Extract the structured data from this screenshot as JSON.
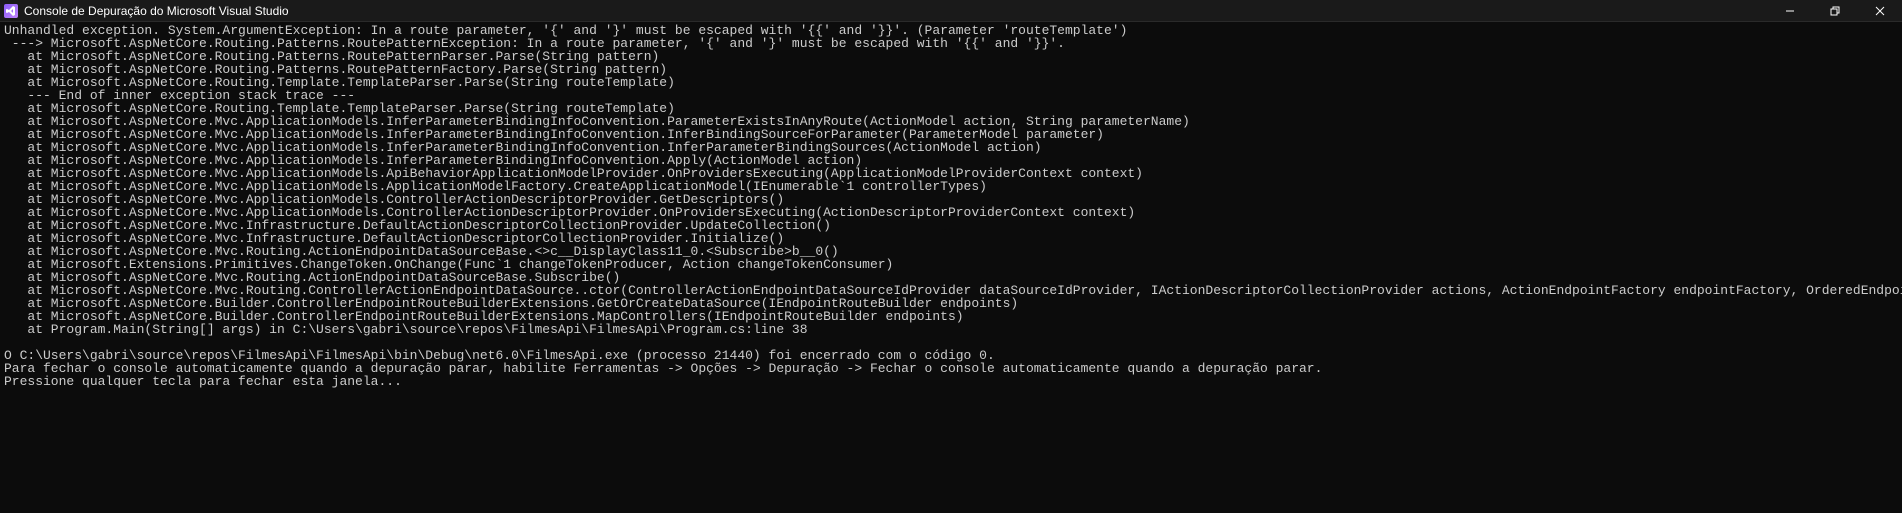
{
  "titlebar": {
    "icon_text": "VS",
    "title": "Console de Depuração do Microsoft Visual Studio"
  },
  "console": {
    "lines": [
      "Unhandled exception. System.ArgumentException: In a route parameter, '{' and '}' must be escaped with '{{' and '}}'. (Parameter 'routeTemplate')",
      " ---> Microsoft.AspNetCore.Routing.Patterns.RoutePatternException: In a route parameter, '{' and '}' must be escaped with '{{' and '}}'.",
      "   at Microsoft.AspNetCore.Routing.Patterns.RoutePatternParser.Parse(String pattern)",
      "   at Microsoft.AspNetCore.Routing.Patterns.RoutePatternFactory.Parse(String pattern)",
      "   at Microsoft.AspNetCore.Routing.Template.TemplateParser.Parse(String routeTemplate)",
      "   --- End of inner exception stack trace ---",
      "   at Microsoft.AspNetCore.Routing.Template.TemplateParser.Parse(String routeTemplate)",
      "   at Microsoft.AspNetCore.Mvc.ApplicationModels.InferParameterBindingInfoConvention.ParameterExistsInAnyRoute(ActionModel action, String parameterName)",
      "   at Microsoft.AspNetCore.Mvc.ApplicationModels.InferParameterBindingInfoConvention.InferBindingSourceForParameter(ParameterModel parameter)",
      "   at Microsoft.AspNetCore.Mvc.ApplicationModels.InferParameterBindingInfoConvention.InferParameterBindingSources(ActionModel action)",
      "   at Microsoft.AspNetCore.Mvc.ApplicationModels.InferParameterBindingInfoConvention.Apply(ActionModel action)",
      "   at Microsoft.AspNetCore.Mvc.ApplicationModels.ApiBehaviorApplicationModelProvider.OnProvidersExecuting(ApplicationModelProviderContext context)",
      "   at Microsoft.AspNetCore.Mvc.ApplicationModels.ApplicationModelFactory.CreateApplicationModel(IEnumerable`1 controllerTypes)",
      "   at Microsoft.AspNetCore.Mvc.ApplicationModels.ControllerActionDescriptorProvider.GetDescriptors()",
      "   at Microsoft.AspNetCore.Mvc.ApplicationModels.ControllerActionDescriptorProvider.OnProvidersExecuting(ActionDescriptorProviderContext context)",
      "   at Microsoft.AspNetCore.Mvc.Infrastructure.DefaultActionDescriptorCollectionProvider.UpdateCollection()",
      "   at Microsoft.AspNetCore.Mvc.Infrastructure.DefaultActionDescriptorCollectionProvider.Initialize()",
      "   at Microsoft.AspNetCore.Mvc.Routing.ActionEndpointDataSourceBase.<>c__DisplayClass11_0.<Subscribe>b__0()",
      "   at Microsoft.Extensions.Primitives.ChangeToken.OnChange(Func`1 changeTokenProducer, Action changeTokenConsumer)",
      "   at Microsoft.AspNetCore.Mvc.Routing.ActionEndpointDataSourceBase.Subscribe()",
      "   at Microsoft.AspNetCore.Mvc.Routing.ControllerActionEndpointDataSource..ctor(ControllerActionEndpointDataSourceIdProvider dataSourceIdProvider, IActionDescriptorCollectionProvider actions, ActionEndpointFactory endpointFactory, OrderedEndpointsSequenceProvider orderSequence)",
      "   at Microsoft.AspNetCore.Builder.ControllerEndpointRouteBuilderExtensions.GetOrCreateDataSource(IEndpointRouteBuilder endpoints)",
      "   at Microsoft.AspNetCore.Builder.ControllerEndpointRouteBuilderExtensions.MapControllers(IEndpointRouteBuilder endpoints)",
      "   at Program.Main(String[] args) in C:\\Users\\gabri\\source\\repos\\FilmesApi\\FilmesApi\\Program.cs:line 38",
      "",
      "O C:\\Users\\gabri\\source\\repos\\FilmesApi\\FilmesApi\\bin\\Debug\\net6.0\\FilmesApi.exe (processo 21440) foi encerrado com o código 0.",
      "Para fechar o console automaticamente quando a depuração parar, habilite Ferramentas -> Opções -> Depuração -> Fechar o console automaticamente quando a depuração parar.",
      "Pressione qualquer tecla para fechar esta janela..."
    ]
  }
}
